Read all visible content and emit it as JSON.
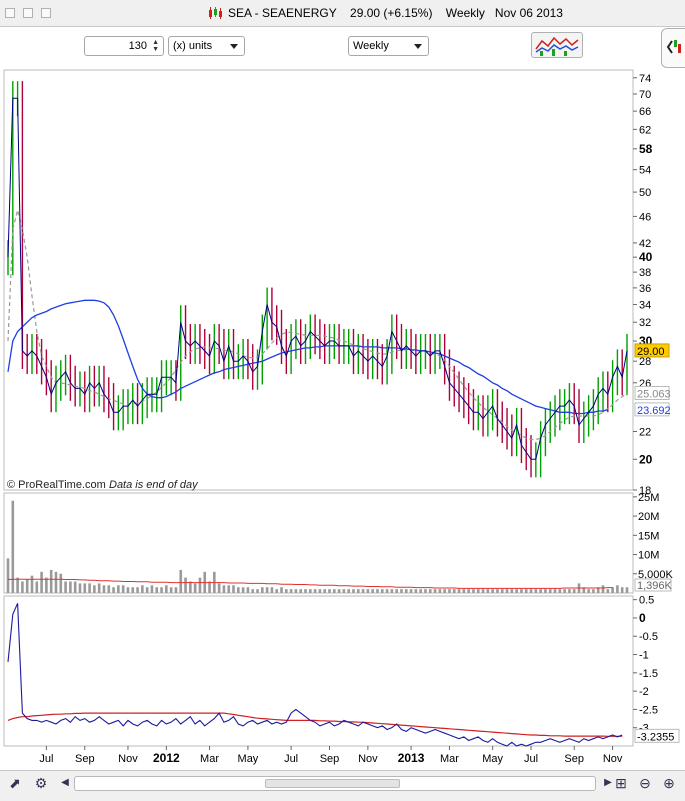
{
  "window": {
    "title": "SEA - SEAENERGY",
    "price": "29.00 (+6.15%)",
    "period": "Weekly",
    "date": "Nov 06 2013"
  },
  "toolbar": {
    "units_value": "130",
    "units_label": "(x) units",
    "timeframe": "Weekly"
  },
  "icons": [
    "candlestick-icon",
    "indicators-icon",
    "back-icon",
    "forward-icon",
    "zoom-select-icon",
    "zoom-out-icon",
    "zoom-in-icon"
  ],
  "colors": {
    "up_bar": "#00a000",
    "down_bar": "#b0003a",
    "close_line": "#000080",
    "ma_long": "#1f3fe0",
    "ma_short": "#999999",
    "volume_bar": "#9a9a9a",
    "volume_ma": "#e03030",
    "osc_line": "#1a1aa0",
    "osc_signal": "#d02020",
    "last_price_bg": "#ffcc00"
  },
  "chart_data": {
    "type": "line",
    "title": "SEA - SEAENERGY Weekly",
    "watermark": "© ProRealTime.com",
    "note": "Data is end of day",
    "x_ticks": [
      "Jul",
      "Sep",
      "Nov",
      "2012",
      "Mar",
      "May",
      "Jul",
      "Sep",
      "Nov",
      "2013",
      "Mar",
      "May",
      "Jul",
      "Sep",
      "Nov"
    ],
    "price_panel": {
      "scale": "log",
      "y_ticks": [
        "74",
        "70",
        "66",
        "62",
        "58",
        "54",
        "50",
        "46",
        "42",
        "40",
        "38",
        "36",
        "34",
        "32",
        "30",
        "28",
        "26",
        "22",
        "20",
        "18"
      ],
      "bold_ticks": [
        "58",
        "40",
        "30",
        "20"
      ],
      "ylim": [
        18,
        76
      ],
      "last_price": "29.00",
      "ma_long_label": "23.692",
      "ma_short_label": "25.063",
      "close": [
        40,
        69,
        69,
        29,
        28.5,
        29,
        28.5,
        27.5,
        26.5,
        25,
        26,
        26.5,
        27,
        26,
        25.5,
        25.5,
        25,
        26,
        25.5,
        26,
        25,
        24.5,
        23.5,
        23.5,
        24,
        24,
        24.5,
        24,
        24.5,
        25,
        25,
        25,
        26.5,
        26.5,
        26.5,
        26,
        32,
        30,
        29.5,
        30,
        29.5,
        29,
        28.5,
        30,
        29.5,
        28,
        29.5,
        28,
        28,
        28.5,
        28,
        27,
        27.5,
        31,
        34,
        32,
        31.5,
        29.5,
        28.5,
        30,
        30.5,
        29.5,
        30,
        31,
        30.5,
        30,
        29.5,
        30,
        30,
        29.5,
        29.5,
        29.5,
        28.5,
        29,
        28.5,
        28,
        28.5,
        28,
        27.5,
        28.5,
        31,
        30,
        29,
        29.5,
        29,
        28.5,
        29,
        29,
        28.5,
        29,
        29,
        27.5,
        26,
        25.5,
        25,
        24.5,
        24,
        23.5,
        23.5,
        23,
        23.5,
        24,
        23,
        22.5,
        22,
        21.5,
        22.5,
        21,
        20.5,
        20,
        20,
        21.5,
        22.5,
        23,
        23.5,
        24,
        24,
        24.5,
        24,
        22.5,
        23,
        23.5,
        24,
        25,
        25.5,
        25,
        26.5,
        27.5,
        26.5,
        29
      ],
      "ma_short": [
        30,
        44,
        47,
        44,
        40,
        35,
        31,
        28.5,
        27.5,
        26.5,
        26,
        26,
        25.9,
        25.8,
        25.7,
        25.6,
        25.5,
        25.3,
        25.2,
        25,
        24.8,
        24.6,
        24.5,
        24.3,
        24.2,
        24.2,
        24.2,
        24.3,
        24.4,
        24.6,
        24.9,
        25.2,
        25.6,
        26,
        26.5,
        27.2,
        27.9,
        28.5,
        28.9,
        29.2,
        29.3,
        29.4,
        29.3,
        29.3,
        29.2,
        29.1,
        29,
        28.9,
        28.7,
        28.5,
        28.4,
        28.3,
        28.4,
        28.7,
        29.2,
        29.8,
        30.3,
        30.7,
        30.9,
        30.9,
        30.8,
        30.7,
        30.6,
        30.6,
        30.6,
        30.6,
        30.5,
        30.4,
        30.3,
        30.1,
        30,
        29.8,
        29.6,
        29.4,
        29.2,
        29.1,
        28.9,
        28.8,
        28.7,
        28.7,
        28.9,
        29,
        29.1,
        29.1,
        29.1,
        29,
        29,
        28.9,
        28.8,
        28.7,
        28.5,
        28.1,
        27.5,
        26.9,
        26.3,
        25.7,
        25.2,
        24.7,
        24.3,
        23.9,
        23.6,
        23.3,
        23,
        22.7,
        22.4,
        22.1,
        21.9,
        21.7,
        21.5,
        21.4,
        21.4,
        21.5,
        21.7,
        22,
        22.3,
        22.6,
        22.9,
        23.1,
        23.2,
        23.2,
        23.2,
        23.2,
        23.2,
        23.3,
        23.5,
        23.8,
        24.1,
        24.5,
        24.8,
        25.1
      ],
      "ma_long": [
        27,
        30,
        31,
        31.5,
        32,
        32.5,
        32.8,
        33,
        33.2,
        33.5,
        33.7,
        33.9,
        34.1,
        34.2,
        34.3,
        34.4,
        34.5,
        34.5,
        34.5,
        34.4,
        34.2,
        33.7,
        32.8,
        31.6,
        30.2,
        28.8,
        27.5,
        26.3,
        25.5,
        25,
        24.8,
        24.7,
        24.7,
        24.8,
        25,
        25.2,
        25.5,
        25.7,
        25.9,
        26.1,
        26.3,
        26.5,
        26.7,
        26.9,
        27,
        27.2,
        27.3,
        27.4,
        27.5,
        27.6,
        27.7,
        27.8,
        27.9,
        28,
        28.2,
        28.4,
        28.6,
        28.8,
        28.9,
        29,
        29.1,
        29.2,
        29.3,
        29.3,
        29.4,
        29.4,
        29.5,
        29.5,
        29.5,
        29.5,
        29.5,
        29.5,
        29.5,
        29.5,
        29.4,
        29.4,
        29.4,
        29.4,
        29.3,
        29.3,
        29.3,
        29.3,
        29.2,
        29.2,
        29.1,
        29.1,
        29,
        29,
        28.9,
        28.8,
        28.7,
        28.5,
        28.3,
        28.1,
        27.9,
        27.6,
        27.4,
        27.1,
        26.8,
        26.6,
        26.3,
        26,
        25.8,
        25.5,
        25.3,
        25,
        24.8,
        24.6,
        24.4,
        24.2,
        24,
        23.9,
        23.8,
        23.7,
        23.6,
        23.5,
        23.5,
        23.5,
        23.4,
        23.4,
        23.4,
        23.5,
        23.5,
        23.6,
        23.6,
        23.7
      ]
    },
    "volume_panel": {
      "y_ticks": [
        "25M",
        "20M",
        "15M",
        "10M",
        "5,000K"
      ],
      "ylim": [
        0,
        26000000
      ],
      "last_label": "1,396K",
      "values": [
        9,
        24,
        4,
        3,
        3.5,
        4.5,
        3,
        5.5,
        4,
        6,
        5.5,
        5,
        3,
        3,
        3,
        2.5,
        2.5,
        2.5,
        2,
        2.5,
        2,
        2,
        1.5,
        2,
        2,
        1.5,
        1.5,
        1.5,
        2,
        1.5,
        2,
        1.5,
        1.5,
        2,
        1.5,
        1.5,
        6,
        4,
        3,
        2.5,
        4,
        5.5,
        3,
        5.5,
        2.5,
        2,
        2,
        2,
        1.5,
        1.5,
        1.5,
        1,
        1,
        1.5,
        1.5,
        1.5,
        1,
        1.5,
        1,
        1,
        1,
        1,
        1,
        1,
        1,
        1,
        1,
        1,
        1,
        1,
        1,
        1,
        1,
        1,
        1,
        1,
        1,
        1,
        1,
        1,
        1,
        1,
        1,
        1,
        1,
        1,
        1,
        1,
        1,
        1,
        1,
        1,
        1,
        1,
        1,
        1,
        1,
        1,
        1,
        1,
        1,
        1,
        1,
        1,
        1,
        1,
        1,
        1,
        1,
        1,
        1,
        1,
        1,
        1,
        1,
        1,
        1,
        1,
        1,
        2.5,
        1.5,
        1,
        1,
        1.5,
        2,
        1,
        1.5,
        2,
        1.5,
        1.5
      ],
      "ma": [
        3.5,
        3.6,
        3.6,
        3.6,
        3.6,
        3.6,
        3.6,
        3.6,
        3.6,
        3.6,
        3.6,
        3.6,
        3.5,
        3.5,
        3.5,
        3.4,
        3.4,
        3.3,
        3.3,
        3.2,
        3.2,
        3.2,
        3.1,
        3.1,
        3,
        3,
        3,
        2.9,
        2.9,
        2.9,
        2.8,
        2.8,
        2.8,
        2.8,
        2.7,
        2.7,
        2.7,
        2.7,
        2.7,
        2.7,
        2.7,
        2.7,
        2.7,
        2.7,
        2.7,
        2.7,
        2.6,
        2.6,
        2.6,
        2.6,
        2.5,
        2.5,
        2.5,
        2.5,
        2.4,
        2.4,
        2.4,
        2.3,
        2.3,
        2.3,
        2.2,
        2.2,
        2.2,
        2.1,
        2.1,
        2,
        2,
        2,
        2,
        1.9,
        1.9,
        1.9,
        1.8,
        1.8,
        1.8,
        1.7,
        1.7,
        1.7,
        1.6,
        1.6,
        1.6,
        1.5,
        1.5,
        1.5,
        1.5,
        1.4,
        1.4,
        1.4,
        1.4,
        1.3,
        1.3,
        1.3,
        1.3,
        1.3,
        1.2,
        1.2,
        1.2,
        1.2,
        1.2,
        1.2,
        1.2,
        1.2,
        1.2,
        1.2,
        1.2,
        1.2,
        1.2,
        1.2,
        1.2,
        1.2,
        1.2,
        1.2,
        1.2,
        1.2,
        1.2,
        1.2,
        1.3,
        1.3,
        1.3,
        1.3,
        1.3,
        1.3,
        1.3,
        1.3,
        1.3,
        1.4,
        1.4
      ]
    },
    "oscillator_panel": {
      "y_ticks": [
        "0.5",
        "0",
        "-0.5",
        "-1",
        "-1.5",
        "-2",
        "-2.5",
        "-3"
      ],
      "bold_ticks": [
        "0"
      ],
      "ylim": [
        -3.5,
        0.6
      ],
      "last_label": "-3.2355",
      "line": [
        -1.2,
        0.1,
        0.4,
        -2.6,
        -2.75,
        -2.8,
        -2.8,
        -2.85,
        -2.8,
        -2.85,
        -2.9,
        -2.8,
        -2.75,
        -2.85,
        -2.7,
        -2.8,
        -2.75,
        -2.85,
        -2.8,
        -2.7,
        -2.8,
        -2.9,
        -2.85,
        -2.8,
        -2.95,
        -2.8,
        -2.9,
        -2.95,
        -2.85,
        -2.8,
        -2.9,
        -2.95,
        -2.8,
        -2.9,
        -2.85,
        -2.75,
        -2.9,
        -2.8,
        -2.7,
        -2.9,
        -2.8,
        -2.95,
        -2.85,
        -2.75,
        -2.6,
        -2.85,
        -2.8,
        -2.7,
        -2.9,
        -2.95,
        -2.85,
        -2.8,
        -2.9,
        -2.85,
        -2.8,
        -2.9,
        -2.85,
        -2.9,
        -2.85,
        -2.6,
        -2.5,
        -2.6,
        -2.7,
        -2.8,
        -2.85,
        -2.95,
        -2.9,
        -2.85,
        -2.95,
        -2.9,
        -2.8,
        -2.85,
        -2.9,
        -2.95,
        -2.85,
        -2.9,
        -2.95,
        -3.0,
        -2.95,
        -3.05,
        -3.0,
        -2.9,
        -3.05,
        -3.1,
        -3.0,
        -3.05,
        -3.1,
        -3.15,
        -3.1,
        -3.05,
        -3.1,
        -3.15,
        -3.2,
        -3.25,
        -3.3,
        -3.25,
        -3.35,
        -3.3,
        -3.25,
        -3.35,
        -3.4,
        -3.3,
        -3.4,
        -3.45,
        -3.5,
        -3.4,
        -3.5,
        -3.45,
        -3.5,
        -3.45,
        -3.4,
        -3.4,
        -3.35,
        -3.3,
        -3.35,
        -3.4,
        -3.35,
        -3.3,
        -3.35,
        -3.4,
        -3.3,
        -3.35,
        -3.3,
        -3.25,
        -3.3,
        -3.25,
        -3.2,
        -3.25,
        -3.2
      ],
      "signal": [
        -2.8,
        -2.75,
        -2.72,
        -2.7,
        -2.7,
        -2.68,
        -2.67,
        -2.66,
        -2.65,
        -2.64,
        -2.63,
        -2.63,
        -2.62,
        -2.62,
        -2.61,
        -2.61,
        -2.6,
        -2.6,
        -2.6,
        -2.6,
        -2.6,
        -2.6,
        -2.6,
        -2.6,
        -2.6,
        -2.6,
        -2.6,
        -2.6,
        -2.6,
        -2.6,
        -2.6,
        -2.6,
        -2.6,
        -2.6,
        -2.6,
        -2.6,
        -2.6,
        -2.6,
        -2.6,
        -2.6,
        -2.6,
        -2.6,
        -2.6,
        -2.6,
        -2.6,
        -2.6,
        -2.62,
        -2.64,
        -2.66,
        -2.68,
        -2.7,
        -2.72,
        -2.74,
        -2.75,
        -2.76,
        -2.77,
        -2.78,
        -2.79,
        -2.8,
        -2.8,
        -2.8,
        -2.8,
        -2.8,
        -2.8,
        -2.8,
        -2.81,
        -2.81,
        -2.82,
        -2.82,
        -2.83,
        -2.83,
        -2.84,
        -2.84,
        -2.85,
        -2.85,
        -2.86,
        -2.87,
        -2.88,
        -2.89,
        -2.9,
        -2.91,
        -2.92,
        -2.93,
        -2.94,
        -2.95,
        -2.96,
        -2.97,
        -2.98,
        -2.99,
        -3.0,
        -3.01,
        -3.02,
        -3.03,
        -3.04,
        -3.05,
        -3.06,
        -3.07,
        -3.08,
        -3.09,
        -3.1,
        -3.11,
        -3.12,
        -3.13,
        -3.14,
        -3.15,
        -3.16,
        -3.17,
        -3.18,
        -3.19,
        -3.2,
        -3.2,
        -3.21,
        -3.21,
        -3.22,
        -3.22,
        -3.22,
        -3.23,
        -3.23,
        -3.23,
        -3.23,
        -3.23,
        -3.23,
        -3.23,
        -3.23,
        -3.23,
        -3.235,
        -3.235,
        -3.235,
        -3.2355
      ]
    }
  }
}
